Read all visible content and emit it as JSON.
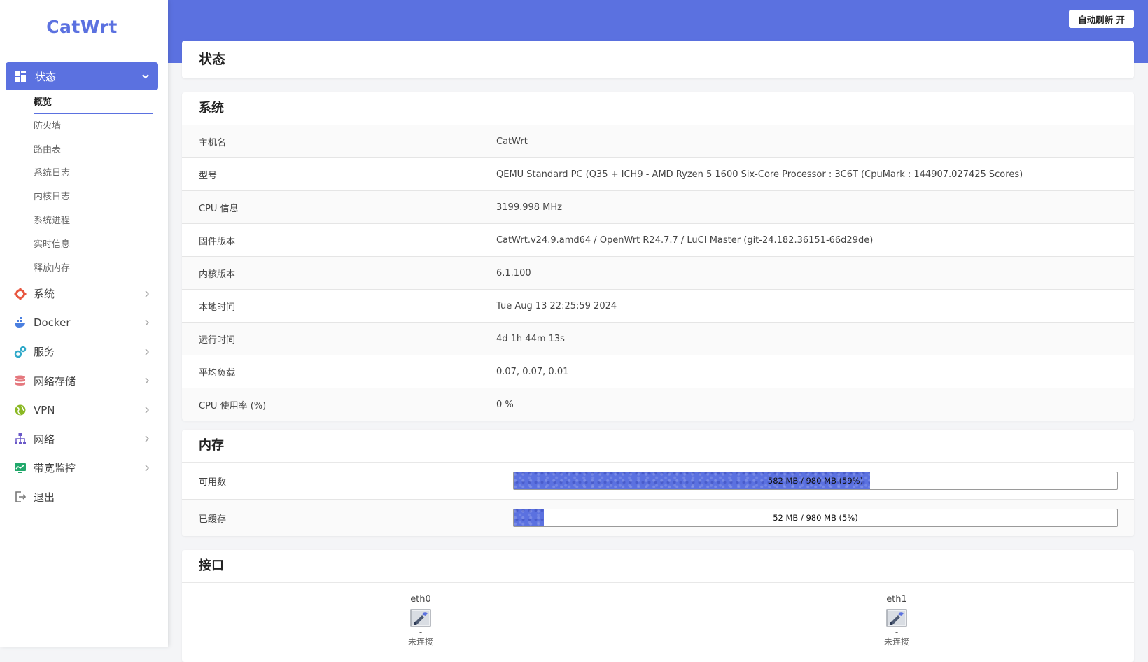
{
  "app": {
    "logo": "CatWrt",
    "refresh_button": "自动刷新 开"
  },
  "sidebar": {
    "active_group": {
      "label": "状态",
      "icon": "dashboard-grid-icon"
    },
    "sub_items": [
      {
        "label": "概览",
        "active": true
      },
      {
        "label": "防火墙"
      },
      {
        "label": "路由表"
      },
      {
        "label": "系统日志"
      },
      {
        "label": "内核日志"
      },
      {
        "label": "系统进程"
      },
      {
        "label": "实时信息"
      },
      {
        "label": "释放内存"
      }
    ],
    "items": [
      {
        "label": "系统",
        "icon": "gear-icon",
        "color": "#e8563f"
      },
      {
        "label": "Docker",
        "icon": "docker-whale-icon",
        "color": "#4a7fe0"
      },
      {
        "label": "服务",
        "icon": "services-gears-icon",
        "color": "#30a9c9"
      },
      {
        "label": "网络存储",
        "icon": "database-icon",
        "color": "#e5787e"
      },
      {
        "label": "VPN",
        "icon": "globe-icon",
        "color": "#8ab822"
      },
      {
        "label": "网络",
        "icon": "network-tree-icon",
        "color": "#6a58c8"
      },
      {
        "label": "带宽监控",
        "icon": "monitor-chart-icon",
        "color": "#21a86b"
      },
      {
        "label": "退出",
        "icon": "logout-icon",
        "color": "#666666"
      }
    ]
  },
  "page": {
    "title": "状态"
  },
  "system": {
    "title": "系统",
    "rows": [
      {
        "key": "主机名",
        "value": "CatWrt"
      },
      {
        "key": "型号",
        "value": "QEMU Standard PC (Q35 + ICH9 - AMD Ryzen 5 1600 Six-Core Processor : 3C6T (CpuMark : 144907.027425 Scores)"
      },
      {
        "key": "CPU 信息",
        "value": "3199.998 MHz"
      },
      {
        "key": "固件版本",
        "value": "CatWrt.v24.9.amd64 / OpenWrt R24.7.7 / LuCI Master (git-24.182.36151-66d29de)"
      },
      {
        "key": "内核版本",
        "value": "6.1.100"
      },
      {
        "key": "本地时间",
        "value": "Tue Aug 13 22:25:59 2024"
      },
      {
        "key": "运行时间",
        "value": "4d 1h 44m 13s"
      },
      {
        "key": "平均负载",
        "value": "0.07, 0.07, 0.01"
      },
      {
        "key": "CPU 使用率 (%)",
        "value": "0 %"
      }
    ]
  },
  "memory": {
    "title": "内存",
    "rows": [
      {
        "key": "可用数",
        "text": "582 MB / 980 MB (59%)",
        "percent": 59
      },
      {
        "key": "已缓存",
        "text": "52 MB / 980 MB (5%)",
        "percent": 5
      }
    ]
  },
  "interfaces": {
    "title": "接口",
    "ports": [
      {
        "name": "eth0",
        "status": "-",
        "label_cut": "未连接"
      },
      {
        "name": "eth1",
        "status": "-",
        "label_cut": "未连接"
      }
    ]
  },
  "colors": {
    "accent": "#5b71e0"
  }
}
